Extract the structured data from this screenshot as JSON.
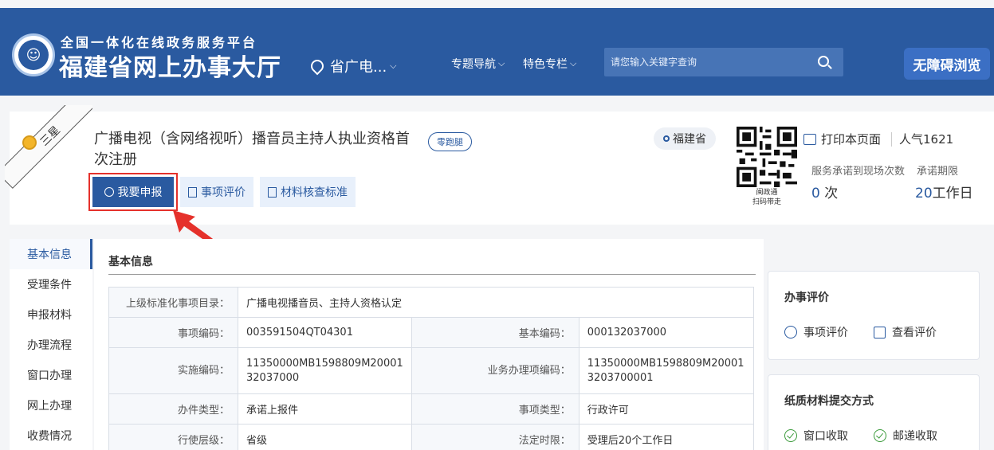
{
  "header": {
    "logo_subtitle": "全国一体化在线政务服务平台",
    "logo_title": "福建省网上办事大厅",
    "location": "省广电...",
    "nav": [
      "专题导航",
      "特色专栏"
    ],
    "search_placeholder": "请您输入关键字查询",
    "accessibility_label": "无障碍浏览",
    "brand_color": "#2a5aa0"
  },
  "item": {
    "star_ribbon": "三星",
    "title": "广播电视（含网络视听）播音员主持人执业资格首次注册",
    "zero_badge": "零跑腿",
    "buttons": {
      "apply": "我要申报",
      "evaluate": "事项评价",
      "materials": "材料核查标准"
    },
    "province": "福建省",
    "qr_caption_1": "闽政通",
    "qr_caption_2": "扫码带走",
    "print_label": "打印本页面",
    "popularity": "人气1621",
    "stat1_label": "服务承诺到现场次数",
    "stat1_value": "0",
    "stat1_unit": "次",
    "stat2_label": "承诺期限",
    "stat2_value": "20",
    "stat2_unit": "工作日"
  },
  "left_nav": [
    "基本信息",
    "受理条件",
    "申报材料",
    "办理流程",
    "窗口办理",
    "网上办理",
    "收费情况"
  ],
  "basic_info": {
    "title": "基本信息",
    "row1_label": "上级标准化事项目录：",
    "row1_value": "广播电视播音员、主持人资格认定",
    "rows": [
      {
        "l1": "事项编码：",
        "v1": "003591504QT04301",
        "l2": "基本编码：",
        "v2": "000132037000"
      },
      {
        "l1": "实施编码：",
        "v1": "11350000MB1598809M20001 32037000",
        "l2": "业务办理项编码：",
        "v2": "11350000MB1598809M20001 3203700001"
      },
      {
        "l1": "办件类型：",
        "v1": "承诺上报件",
        "l2": "事项类型：",
        "v2": "行政许可"
      },
      {
        "l1": "行使层级：",
        "v1": "省级",
        "l2": "法定时限：",
        "v2": "受理后20个工作日"
      }
    ]
  },
  "side": {
    "eval_title": "办事评价",
    "eval_link1": "事项评价",
    "eval_link2": "查看评价",
    "paper_title": "纸质材料提交方式",
    "paper_opt1": "窗口收取",
    "paper_opt2": "邮递收取"
  }
}
